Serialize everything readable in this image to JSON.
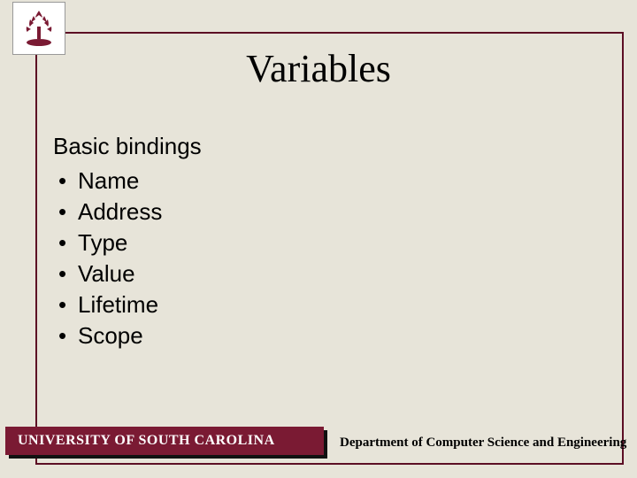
{
  "title": "Variables",
  "content": {
    "heading": "Basic bindings",
    "bullets": [
      "Name",
      "Address",
      "Type",
      "Value",
      "Lifetime",
      "Scope"
    ]
  },
  "footer": {
    "left": "UNIVERSITY OF SOUTH CAROLINA",
    "right": "Department of Computer Science and Engineering"
  },
  "colors": {
    "accent": "#7a1a33",
    "frame": "#5c0e24",
    "background": "#e7e4d9"
  },
  "logo_name": "usc-tree-seal"
}
